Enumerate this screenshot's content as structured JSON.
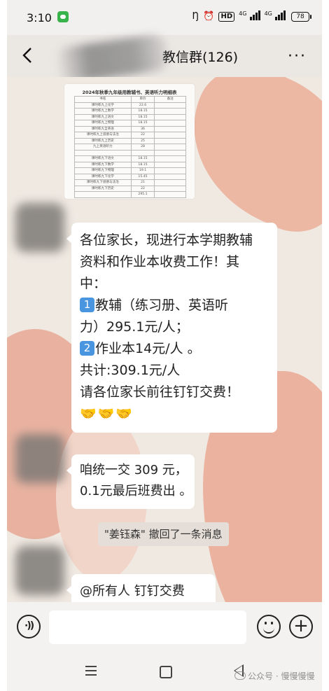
{
  "status_bar": {
    "time": "3:10",
    "network_1": "4G",
    "network_2": "4G",
    "battery": "78"
  },
  "nav": {
    "title": "教信群(126)",
    "more_label": "···"
  },
  "image_message": {
    "title": "2024年秋季九年级用教辅书、英语听力明细表",
    "columns": [
      "书名",
      "单价",
      "备注"
    ],
    "rows": [
      [
        "课时练九上化学",
        "22.6",
        ""
      ],
      [
        "课时练九上数学",
        "18.15",
        ""
      ],
      [
        "课时练九上语文",
        "18.15",
        ""
      ],
      [
        "课时练九上物理",
        "18.15",
        ""
      ],
      [
        "课时练九全英语",
        "36",
        ""
      ],
      [
        "课时练九上道德与法治",
        "22",
        ""
      ],
      [
        "课时练九上历史",
        "25",
        ""
      ],
      [
        "九上英语听力",
        "28",
        ""
      ],
      [
        "",
        "",
        ""
      ],
      [
        "课时练九下语文",
        "18.15",
        ""
      ],
      [
        "课时练九下数学",
        "18.15",
        ""
      ],
      [
        "课时练九下物理",
        "19.1",
        ""
      ],
      [
        "课时练九下化学",
        "15.45",
        ""
      ],
      [
        "课时练九下道德与法治",
        "21",
        ""
      ],
      [
        "课时练九下历史",
        "22",
        ""
      ],
      [
        "",
        "295.1",
        ""
      ]
    ]
  },
  "announcement": {
    "line1": "各位家长，现进行本学期教辅",
    "line2": "资料和作业本收费工作！其",
    "line3": "中：",
    "item1_badge": "1",
    "item1_text": "教辅（练习册、英语听",
    "item1_cont": "力）295.1元/人；",
    "item2_badge": "2",
    "item2_text": "作业本14元/人 。",
    "total": "共计:309.1元/人",
    "instruction": "请各位家长前往钉钉交费！",
    "emoji": "🤝🤝🤝"
  },
  "reply": {
    "line1": "咱统一交 309 元，",
    "line2": "0.1元最后班费出 。"
  },
  "recall_notice": "\"姜钰森\" 撤回了一条消息",
  "at_all_message": "@所有人  钉钉交费",
  "input_bar": {
    "placeholder": "",
    "plus_label": "+"
  },
  "watermark": "公众号 · 慢慢慢慢",
  "colors": {
    "bubble": "#ffffff",
    "chat_background": "#f0e9e2",
    "accent_blob": "#ecb2a0",
    "number_badge": "#4a95e0",
    "wechat_green": "#38b24a"
  }
}
